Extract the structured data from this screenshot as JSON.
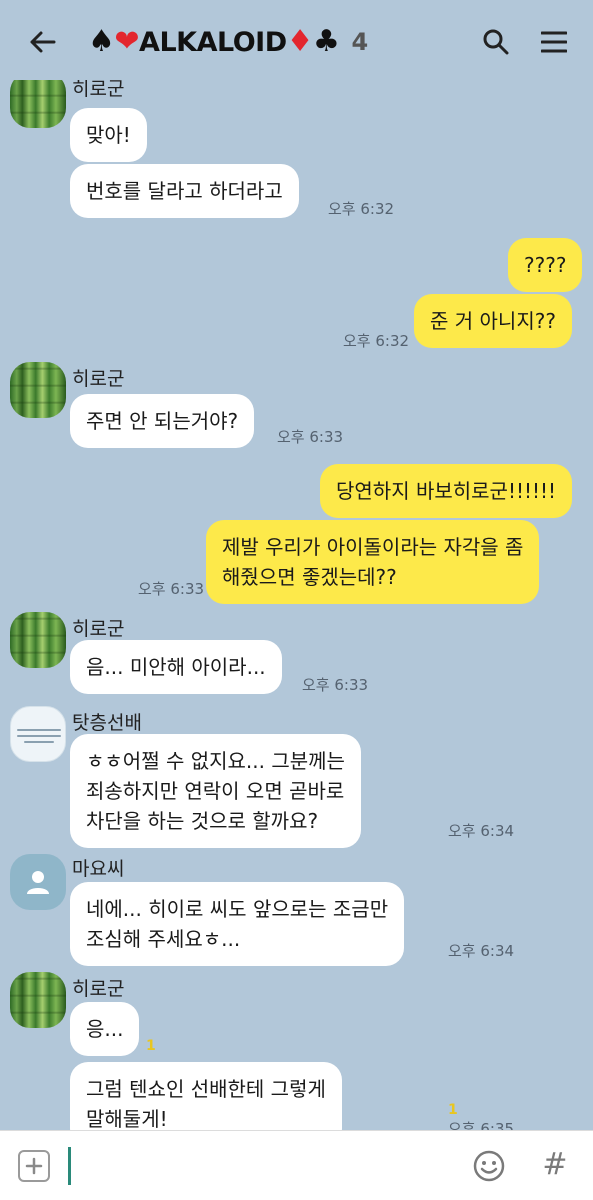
{
  "header": {
    "back_icon": "arrow-left-icon",
    "suits": [
      "♠",
      "❤",
      "♦",
      "♣"
    ],
    "title": "ALKALOID",
    "member_count": "4",
    "search_icon": "search-icon",
    "menu_icon": "hamburger-menu-icon"
  },
  "messages": [
    {
      "sender": "히로군",
      "text": "맞아!",
      "direction": "in"
    },
    {
      "text": "번호를 달라고 하더라고",
      "direction": "in",
      "time": "오후 6:32"
    },
    {
      "text": "????",
      "direction": "out"
    },
    {
      "text": "준 거 아니지??",
      "direction": "out",
      "time": "오후 6:32"
    },
    {
      "sender": "히로군",
      "text": "주면 안 되는거야?",
      "direction": "in",
      "time": "오후 6:33"
    },
    {
      "text": "당연하지 바보히로군!!!!!!",
      "direction": "out"
    },
    {
      "text": "제발 우리가 아이돌이라는 자각을 좀\n해줬으면 좋겠는데??",
      "direction": "out",
      "time": "오후 6:33"
    },
    {
      "sender": "히로군",
      "text": "음... 미안해 아이라...",
      "direction": "in",
      "time": "오후 6:33"
    },
    {
      "sender": "탓층선배",
      "text": "ㅎㅎ어쩔 수 없지요... 그분께는\n죄송하지만 연락이 오면 곧바로\n차단을 하는 것으로 할까요?",
      "direction": "in",
      "time": "오후 6:34"
    },
    {
      "sender": "마요씨",
      "text": "네에... 히이로 씨도 앞으로는 조금만\n조심해 주세요ㅎ...",
      "direction": "in",
      "time": "오후 6:34"
    },
    {
      "sender": "히로군",
      "text": "응...",
      "direction": "in",
      "unread": "1"
    },
    {
      "text": "그럼 텐쇼인 선배한테 그렇게\n말해둘게!",
      "direction": "in",
      "unread": "1",
      "time": "오후 6:35"
    }
  ],
  "input": {
    "placeholder": "",
    "value": "",
    "add_icon": "plus-icon",
    "emoji_icon": "smiley-icon",
    "hash_icon": "hash-icon",
    "hash_label": "#"
  },
  "colors": {
    "background": "#b2c7d9",
    "incoming_bubble": "#ffffff",
    "outgoing_bubble": "#fde94a",
    "unread": "#e8c620"
  }
}
